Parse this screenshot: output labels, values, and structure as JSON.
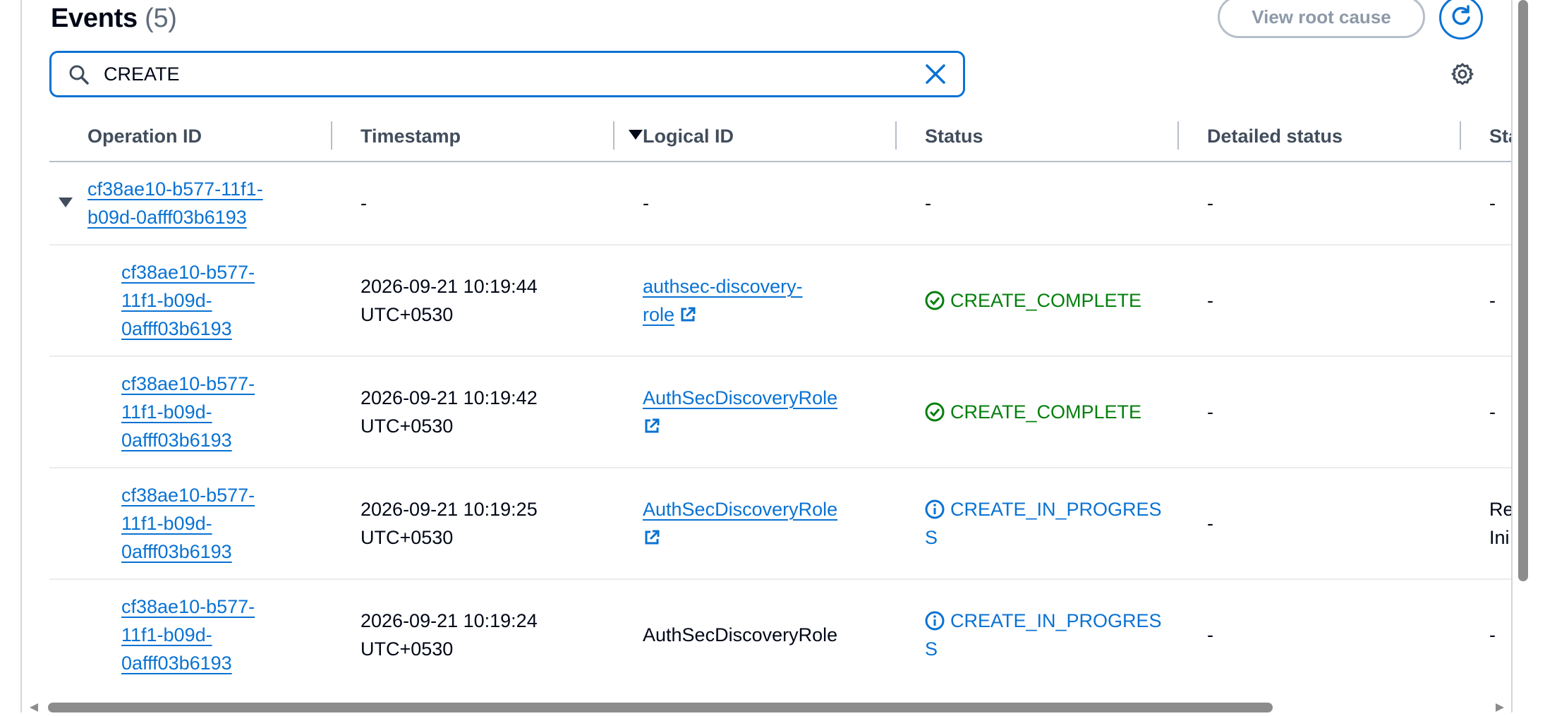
{
  "header": {
    "title": "Events",
    "count": "(5)",
    "view_root_cause_label": "View root cause",
    "refresh_icon": "refresh-icon"
  },
  "search": {
    "value": "CREATE",
    "search_icon": "search-icon",
    "clear_icon": "close-icon"
  },
  "preferences_icon": "gear-icon",
  "columns": [
    "Operation ID",
    "Timestamp",
    "Logical ID",
    "Status",
    "Detailed status",
    "Sta"
  ],
  "sort": {
    "column": "Timestamp",
    "direction": "descending"
  },
  "rows": [
    {
      "operation_id": [
        "cf38ae10-b577-11f1-",
        "b09d-0afff03b6193"
      ],
      "timestamp": "-",
      "logical_id": "-",
      "status": "-",
      "detailed_status": "-",
      "status_reason": "-",
      "expanded": true
    },
    {
      "operation_id": [
        "cf38ae10-b577-",
        "11f1-b09d-",
        "0afff03b6193"
      ],
      "timestamp": [
        "2026-09-21 10:19:44",
        "UTC+0530"
      ],
      "logical_id": [
        "authsec-discovery-",
        "role"
      ],
      "status": "CREATE_COMPLETE",
      "status_type": "success",
      "detailed_status": "-",
      "status_reason": "-"
    },
    {
      "operation_id": [
        "cf38ae10-b577-",
        "11f1-b09d-",
        "0afff03b6193"
      ],
      "timestamp": [
        "2026-09-21 10:19:42",
        "UTC+0530"
      ],
      "logical_id": [
        "AuthSecDiscoveryRole"
      ],
      "status": "CREATE_COMPLETE",
      "status_type": "success",
      "detailed_status": "-",
      "status_reason": "-"
    },
    {
      "operation_id": [
        "cf38ae10-b577-",
        "11f1-b09d-",
        "0afff03b6193"
      ],
      "timestamp": [
        "2026-09-21 10:19:25",
        "UTC+0530"
      ],
      "logical_id": [
        "AuthSecDiscoveryRole"
      ],
      "status": [
        "CREATE_IN_PROGRES",
        "S"
      ],
      "status_type": "info",
      "detailed_status": "-",
      "status_reason": [
        "Re",
        "Ini"
      ]
    },
    {
      "operation_id": [
        "cf38ae10-b577-",
        "11f1-b09d-",
        "0afff03b6193"
      ],
      "timestamp": [
        "2026-09-21 10:19:24",
        "UTC+0530"
      ],
      "logical_id": "AuthSecDiscoveryRole",
      "status": [
        "CREATE_IN_PROGRES",
        "S"
      ],
      "status_type": "info",
      "detailed_status": "-",
      "status_reason": "-"
    }
  ],
  "colors": {
    "link": "#0972d3",
    "success": "#037f0c",
    "header_text": "#414d5c",
    "border": "#b6bec9"
  }
}
